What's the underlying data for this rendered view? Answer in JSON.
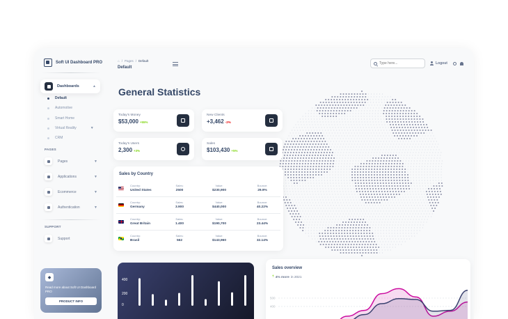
{
  "brand": {
    "name": "Soft UI Dashboard PRO"
  },
  "sidebar": {
    "active": {
      "label": "Dashboards"
    },
    "sub_items": [
      {
        "label": "Default",
        "active": true
      },
      {
        "label": "Automotive",
        "active": false
      },
      {
        "label": "Smart Home",
        "active": false
      },
      {
        "label": "Virtual Reality",
        "active": false,
        "expandable": true
      },
      {
        "label": "CRM",
        "active": false
      }
    ],
    "pages_header": "PAGES",
    "pages": [
      {
        "label": "Pages"
      },
      {
        "label": "Applications"
      },
      {
        "label": "Ecommerce"
      },
      {
        "label": "Authentication"
      }
    ],
    "support_header": "SUPPORT",
    "support": [
      {
        "label": "Support"
      }
    ],
    "promo": {
      "text": "Read more about Soft UI Dashboard PRO",
      "button": "PRODUCT INFO",
      "icon": "diamond-icon"
    }
  },
  "topbar": {
    "breadcrumb": [
      "Pages",
      "Default"
    ],
    "title": "Default",
    "search_placeholder": "Type here...",
    "logout": "Logout"
  },
  "page_title": "General Statistics",
  "stats": [
    {
      "label": "Today's Money",
      "value": "$53,000",
      "change": "+55%",
      "trend": "pos",
      "icon": "wallet-icon"
    },
    {
      "label": "New Clients",
      "value": "+3,462",
      "change": "-2%",
      "trend": "neg",
      "icon": "clipboard-icon"
    },
    {
      "label": "Today's Users",
      "value": "2,300",
      "change": "+3%",
      "trend": "pos",
      "icon": "globe-icon"
    },
    {
      "label": "Sales",
      "value": "$103,430",
      "change": "+5%",
      "trend": "pos",
      "icon": "cart-icon"
    }
  ],
  "sales_by_country": {
    "title": "Sales by Country",
    "headers": {
      "country": "Country:",
      "sales": "Sales:",
      "value": "Value:",
      "bounce": "Bounce:"
    },
    "rows": [
      {
        "country": "United States",
        "sales": "2500",
        "value": "$230,900",
        "bounce": "29.9%",
        "flag": "us"
      },
      {
        "country": "Germany",
        "sales": "3.900",
        "value": "$440,000",
        "bounce": "40.22%",
        "flag": "de"
      },
      {
        "country": "Great Britain",
        "sales": "1.400",
        "value": "$190,700",
        "bounce": "23.44%",
        "flag": "gb"
      },
      {
        "country": "Brasil",
        "sales": "562",
        "value": "$143,960",
        "bounce": "32.14%",
        "flag": "br"
      }
    ]
  },
  "chart_data": [
    {
      "type": "bar",
      "title": "",
      "yticks": [
        "400",
        "200",
        "0"
      ],
      "ylim": [
        0,
        500
      ],
      "values": [
        450,
        190,
        100,
        210,
        500,
        110,
        400,
        220,
        500
      ],
      "grid": false
    },
    {
      "type": "area",
      "title": "Sales overview",
      "subtitle_strong": "4% more",
      "subtitle_rest": "in 2021",
      "yticks": [
        "500",
        "400"
      ],
      "series": [
        {
          "values": [
            0,
            0,
            0,
            30,
            150,
            220,
            420,
            480,
            380,
            150,
            210,
            320
          ],
          "color": "#cb0c9f"
        },
        {
          "values": [
            0,
            0,
            0,
            10,
            90,
            170,
            300,
            360,
            350,
            210,
            220,
            460
          ],
          "color": "#3a416f"
        }
      ]
    }
  ]
}
